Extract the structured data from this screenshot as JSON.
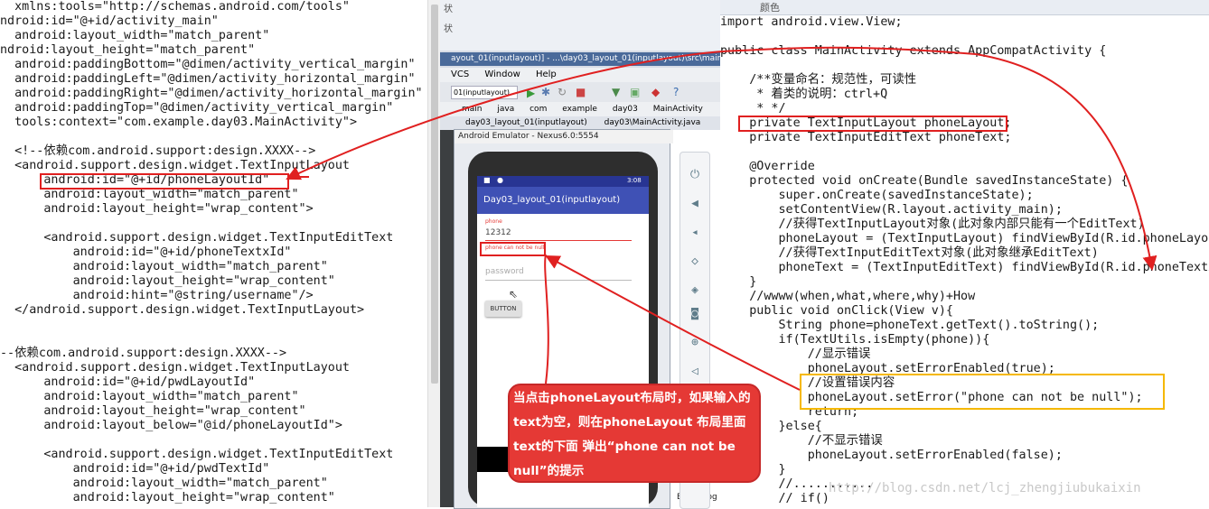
{
  "xml_lines": [
    "  xmlns:tools=\"http://schemas.android.com/tools\"",
    "ndroid:id=\"@+id/activity_main\"",
    "  android:layout_width=\"match_parent\"",
    "ndroid:layout_height=\"match_parent\"",
    "  android:paddingBottom=\"@dimen/activity_vertical_margin\"",
    "  android:paddingLeft=\"@dimen/activity_horizontal_margin\"",
    "  android:paddingRight=\"@dimen/activity_horizontal_margin\"",
    "  android:paddingTop=\"@dimen/activity_vertical_margin\"",
    "  tools:context=\"com.example.day03.MainActivity\">",
    "",
    "  <!--依赖com.android.support:design.XXXX-->",
    "  <android.support.design.widget.TextInputLayout",
    "      android:id=\"@+id/phoneLayoutId\"",
    "      android:layout_width=\"match_parent\"",
    "      android:layout_height=\"wrap_content\">",
    "",
    "      <android.support.design.widget.TextInputEditText",
    "          android:id=\"@+id/phoneTextxId\"",
    "          android:layout_width=\"match_parent\"",
    "          android:layout_height=\"wrap_content\"",
    "          android:hint=\"@string/username\"/>",
    "  </android.support.design.widget.TextInputLayout>",
    "",
    "",
    "--依赖com.android.support:design.XXXX-->",
    "  <android.support.design.widget.TextInputLayout",
    "      android:id=\"@+id/pwdLayoutId\"",
    "      android:layout_width=\"match_parent\"",
    "      android:layout_height=\"wrap_content\"",
    "      android:layout_below=\"@id/phoneLayoutId\">",
    "",
    "      <android.support.design.widget.TextInputEditText",
    "          android:id=\"@+id/pwdTextId\"",
    "          android:layout_width=\"match_parent\"",
    "          android:layout_height=\"wrap_content\""
  ],
  "java_lines": [
    "import android.view.View;",
    "",
    "public class MainActivity extends AppCompatActivity {",
    "",
    "    /**变量命名：规范性，可读性",
    "     * 着类的说明：ctrl+Q",
    "     * */",
    "    private TextInputLayout phoneLayout;",
    "    private TextInputEditText phoneText;",
    "",
    "    @Override",
    "    protected void onCreate(Bundle savedInstanceState) {",
    "        super.onCreate(savedInstanceState);",
    "        setContentView(R.layout.activity_main);",
    "        //获得TextInputLayout对象(此对象内部只能有一个EditText)",
    "        phoneLayout = (TextInputLayout) findViewById(R.id.phoneLayoutId);",
    "        //获得TextInputEditText对象(此对象继承EditText)",
    "        phoneText = (TextInputEditText) findViewById(R.id.phoneTextxId);",
    "    }",
    "    //wwww(when,what,where,why)+How",
    "    public void onClick(View v){",
    "        String phone=phoneText.getText().toString();",
    "        if(TextUtils.isEmpty(phone)){",
    "            //显示错误",
    "            phoneLayout.setErrorEnabled(true);",
    "            //设置错误内容",
    "            phoneLayout.setError(\"phone can not be null\");",
    "            return;",
    "        }else{",
    "            //不显示错误",
    "            phoneLayout.setErrorEnabled(false);",
    "        }",
    "        //...........",
    "        // if()"
  ],
  "ide": {
    "top_label_left": "状",
    "top_label_mid": "颜色",
    "top_label_second": "状",
    "title": "ayout_01(inputlayout)] - ...\\day03_layout_01(inputlayout)\\src\\main\\java",
    "menu": [
      "VCS",
      "Window",
      "Help"
    ],
    "run_config": "01(inputlayout)",
    "nav": [
      "main",
      "java",
      "com",
      "example",
      "day03",
      "MainActivity"
    ],
    "tabs": [
      "day03_layout_01(inputlayout)",
      "day03\\MainActivity.java"
    ],
    "emulator_title": "Android Emulator - Nexus6.0:5554",
    "bottom_tab": "Event Log"
  },
  "phone": {
    "time": "3:08",
    "app_title": "Day03_layout_01(inputlayout)",
    "phone_hint_label": "phone",
    "phone_value": "12312",
    "error_text": "phone can not be null",
    "password_hint": "password",
    "button_label": "BUTTON"
  },
  "callout": "当点击phoneLayout布局时，如果输入的text为空，则在phoneLayout 布局里面text的下面 弹出“phone can not be null”的提示",
  "watermark": "http://blog.csdn.net/lcj_zhengjiubukaixin",
  "colors": {
    "annotation_red": "#e02020",
    "highlight_yellow": "#f5b800",
    "callout_bg": "#e53935",
    "appbar": "#3f51b5",
    "error": "#e53935"
  }
}
